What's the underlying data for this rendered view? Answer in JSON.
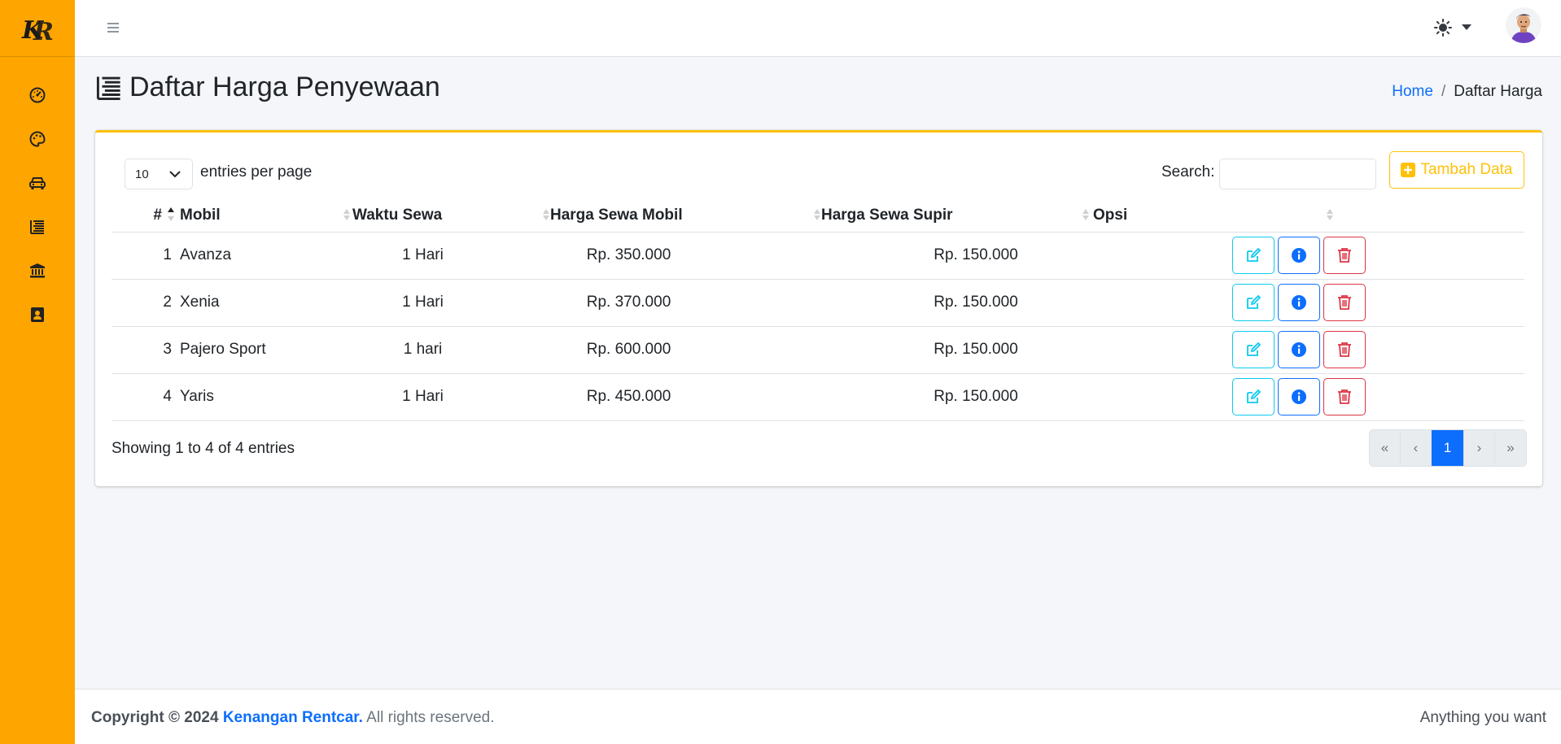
{
  "colors": {
    "sidebar": "#ffa500",
    "warning": "#ffc107",
    "primary": "#0d6efd",
    "info": "#0dcaf0",
    "danger": "#dc3545"
  },
  "sidebar": {
    "logo": "kr-logo",
    "items": [
      {
        "icon": "dashboard-gauge-icon"
      },
      {
        "icon": "palette-icon"
      },
      {
        "icon": "car-icon"
      },
      {
        "icon": "list-icon"
      },
      {
        "icon": "bank-icon"
      },
      {
        "icon": "contact-card-icon"
      }
    ]
  },
  "header": {
    "menu_icon": "hamburger-icon",
    "theme_icon": "sun-icon",
    "avatar_icon": "user-avatar"
  },
  "page": {
    "title": "Daftar Harga Penyewaan",
    "title_icon": "list-icon",
    "breadcrumb": {
      "home": "Home",
      "separator": "/",
      "current": "Daftar Harga"
    }
  },
  "table_controls": {
    "entries_value": "10",
    "entries_label": "entries per page",
    "search_label": "Search:",
    "search_value": "",
    "add_button": "Tambah Data"
  },
  "table": {
    "columns": [
      "#",
      "Mobil",
      "Waktu Sewa",
      "Harga Sewa Mobil",
      "Harga Sewa Supir",
      "Opsi"
    ],
    "rows": [
      {
        "no": "1",
        "mobil": "Avanza",
        "waktu": "1 Hari",
        "harga_mobil": "Rp. 350.000",
        "harga_supir": "Rp. 150.000"
      },
      {
        "no": "2",
        "mobil": "Xenia",
        "waktu": "1 Hari",
        "harga_mobil": "Rp. 370.000",
        "harga_supir": "Rp. 150.000"
      },
      {
        "no": "3",
        "mobil": "Pajero Sport",
        "waktu": "1 hari",
        "harga_mobil": "Rp. 600.000",
        "harga_supir": "Rp. 150.000"
      },
      {
        "no": "4",
        "mobil": "Yaris",
        "waktu": "1 Hari",
        "harga_mobil": "Rp. 450.000",
        "harga_supir": "Rp. 150.000"
      }
    ],
    "info": "Showing 1 to 4 of 4 entries"
  },
  "pagination": {
    "first": "«",
    "prev": "‹",
    "current": "1",
    "next": "›",
    "last": "»"
  },
  "footer": {
    "copyright": "Copyright © 2024",
    "company": "Kenangan Rentcar.",
    "rights": "All rights reserved.",
    "tagline": "Anything you want"
  }
}
